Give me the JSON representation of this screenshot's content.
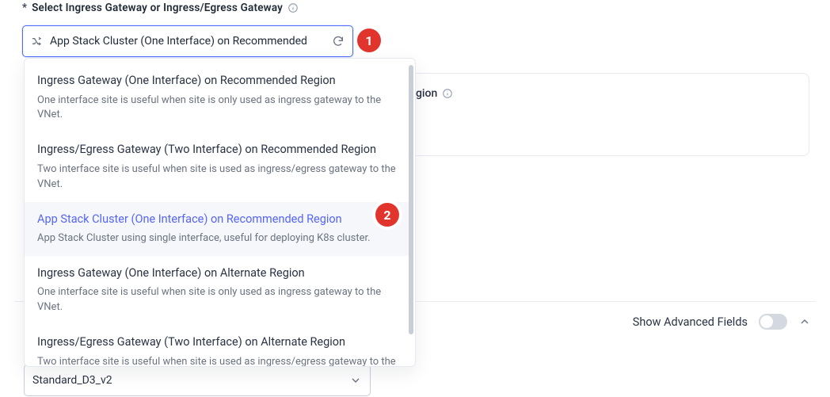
{
  "field": {
    "label": "Select Ingress Gateway or Ingress/Egress Gateway",
    "asterisk": "*",
    "icon": "info-icon",
    "input_value": "App Stack Cluster (One Interface) on Recommended",
    "input_left_icon": "shuffle-icon",
    "input_right_icon": "refresh-icon"
  },
  "dropdown": {
    "options": [
      {
        "title": "Ingress Gateway (One Interface) on Recommended Region",
        "desc": "One interface site is useful when site is only used as ingress gateway to the VNet.",
        "selected": false
      },
      {
        "title": "Ingress/Egress Gateway (Two Interface) on Recommended Region",
        "desc": "Two interface site is useful when site is used as ingress/egress gateway to the VNet.",
        "selected": false
      },
      {
        "title": "App Stack Cluster (One Interface) on Recommended Region",
        "desc": "App Stack Cluster using single interface, useful for deploying K8s cluster.",
        "selected": true
      },
      {
        "title": "Ingress Gateway (One Interface) on Alternate Region",
        "desc": "One interface site is useful when site is only used as ingress gateway to the VNet.",
        "selected": false
      },
      {
        "title": "Ingress/Egress Gateway (Two Interface) on Alternate Region",
        "desc": "Two interface site is useful when site is used as ingress/egress gateway to the VNet.",
        "selected": false
      }
    ]
  },
  "background": {
    "partial_label_suffix": "gion",
    "partial_label_icon": "info-icon"
  },
  "advanced": {
    "label": "Show Advanced Fields",
    "toggle_icon": "toggle-off",
    "chevron_icon": "chevron-up-icon"
  },
  "lower_input": {
    "value": "Standard_D3_v2",
    "chevron_icon": "chevron-down-icon"
  },
  "markers": {
    "one": "1",
    "two": "2"
  }
}
